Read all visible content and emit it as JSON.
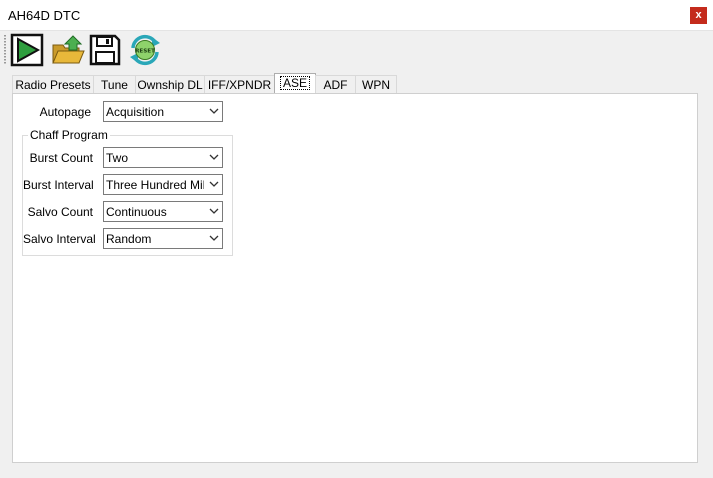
{
  "window": {
    "title": "AH64D DTC",
    "close_label": "x"
  },
  "toolbar": {
    "buttons": [
      {
        "name": "play",
        "icon": "play-icon"
      },
      {
        "name": "open",
        "icon": "folder-open-icon"
      },
      {
        "name": "save",
        "icon": "save-icon"
      },
      {
        "name": "reset",
        "icon": "reset-icon",
        "label": "RESET"
      }
    ]
  },
  "tabs": [
    {
      "label": "Radio Presets"
    },
    {
      "label": "Tune"
    },
    {
      "label": "Ownship DL"
    },
    {
      "label": "IFF/XPNDR"
    },
    {
      "label": "ASE",
      "active": true
    },
    {
      "label": "ADF"
    },
    {
      "label": "WPN"
    }
  ],
  "ase": {
    "autopage": {
      "label": "Autopage",
      "value": "Acquisition"
    },
    "chaff_program": {
      "title": "Chaff Program",
      "burst_count": {
        "label": "Burst Count",
        "value": "Two"
      },
      "burst_interval": {
        "label": "Burst Interval",
        "value": "Three Hundred Millisec"
      },
      "salvo_count": {
        "label": "Salvo Count",
        "value": "Continuous"
      },
      "salvo_interval": {
        "label": "Salvo Interval",
        "value": "Random"
      }
    }
  },
  "colors": {
    "close_button": "#c42b1c",
    "play_green": "#2e9e3e",
    "folder_yellow": "#e8b83a",
    "upload_green": "#4caf50"
  }
}
